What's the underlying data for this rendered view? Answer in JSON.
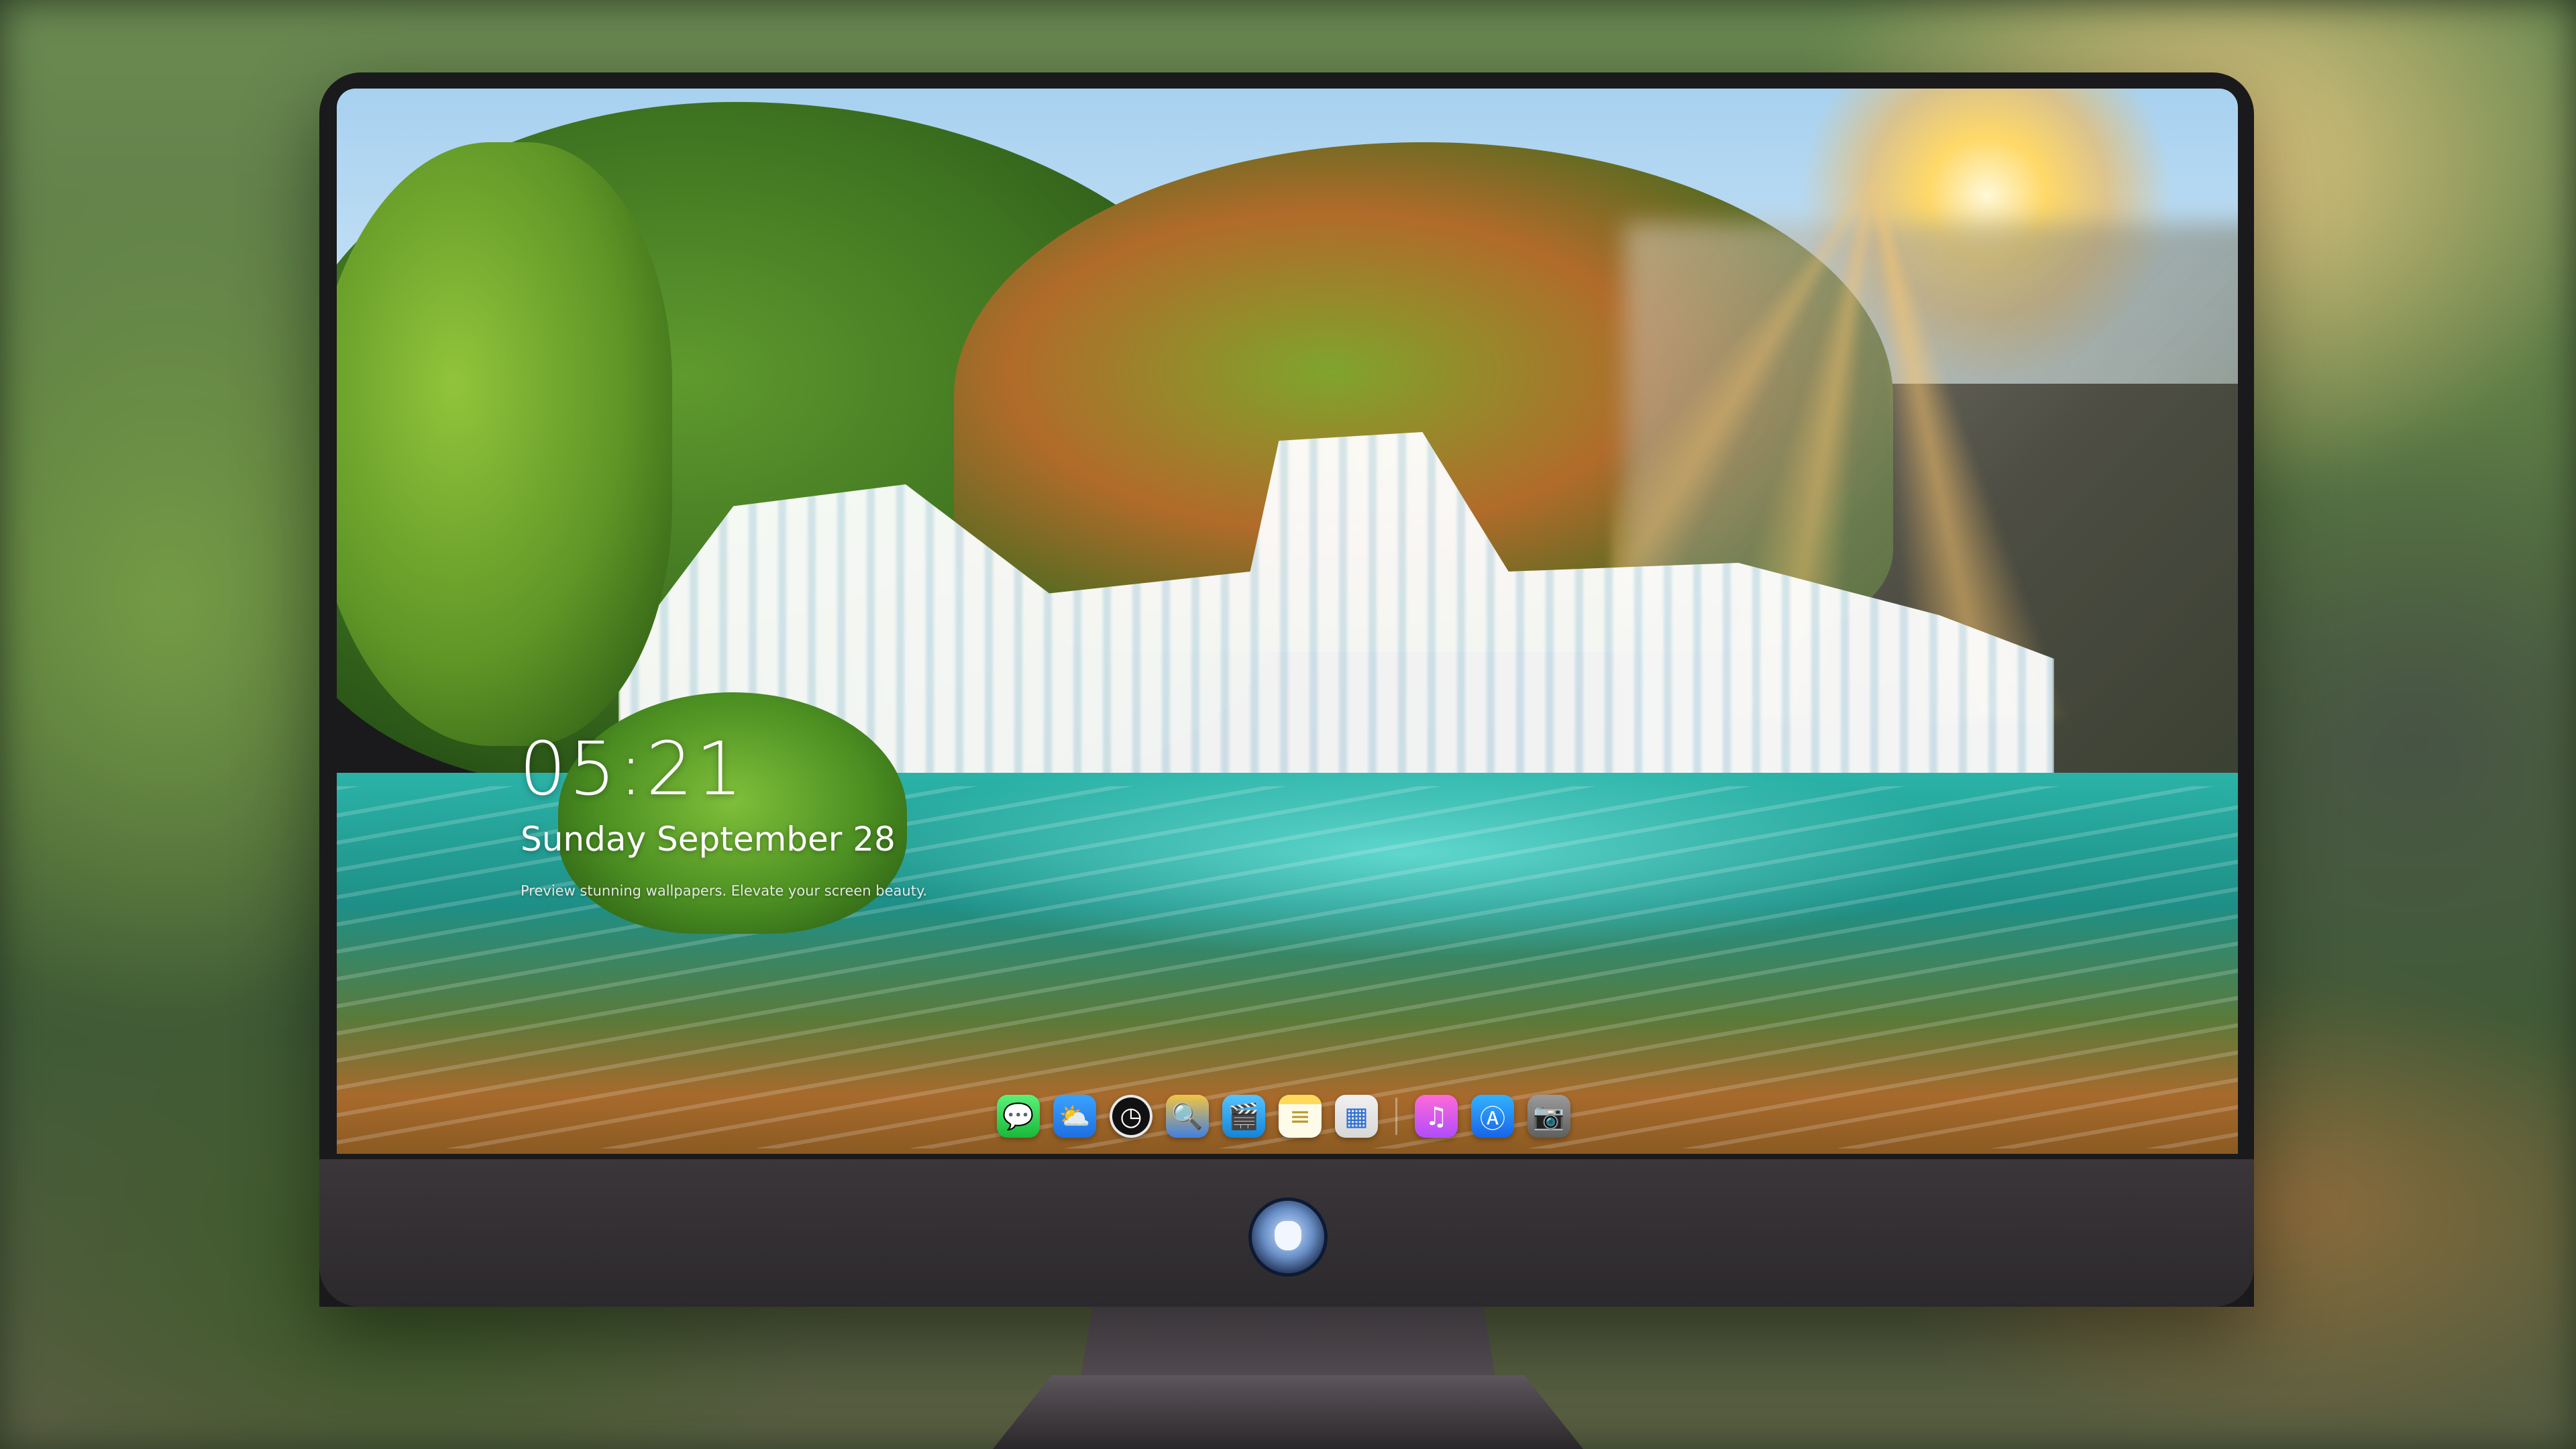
{
  "lockscreen": {
    "time": "05:21",
    "date": "Sunday September 28",
    "caption": "Preview stunning wallpapers. Elevate your screen beauty."
  },
  "dock": {
    "items": [
      {
        "name": "messages",
        "icon": "speech-bubble-icon",
        "glyph": "💬"
      },
      {
        "name": "weather",
        "icon": "cloud-sun-icon",
        "glyph": "⛅"
      },
      {
        "name": "clock",
        "icon": "clock-icon",
        "glyph": "◷"
      },
      {
        "name": "preview",
        "icon": "magnifier-photo-icon",
        "glyph": "🔍"
      },
      {
        "name": "clips",
        "icon": "clapperboard-icon",
        "glyph": "🎬"
      },
      {
        "name": "notes",
        "icon": "notepad-icon",
        "glyph": "≡"
      },
      {
        "name": "photos",
        "icon": "photo-grid-icon",
        "glyph": "▦"
      },
      {
        "name": "music",
        "icon": "music-note-icon",
        "glyph": "♫"
      },
      {
        "name": "app-store",
        "icon": "app-store-icon",
        "glyph": "Ⓐ"
      },
      {
        "name": "camera",
        "icon": "camera-icon",
        "glyph": "📷"
      }
    ]
  }
}
